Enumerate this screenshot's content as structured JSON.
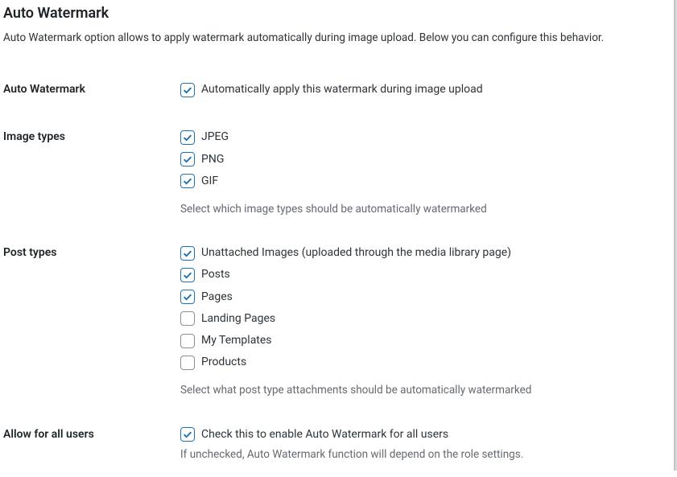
{
  "page": {
    "title": "Auto Watermark",
    "description": "Auto Watermark option allows to apply watermark automatically during image upload. Below you can configure this behavior."
  },
  "sections": {
    "auto_watermark": {
      "heading": "Auto Watermark",
      "option_label": "Automatically apply this watermark during image upload",
      "option_checked": true
    },
    "image_types": {
      "heading": "Image types",
      "items": [
        {
          "label": "JPEG",
          "checked": true
        },
        {
          "label": "PNG",
          "checked": true
        },
        {
          "label": "GIF",
          "checked": true
        }
      ],
      "hint": "Select which image types should be automatically watermarked"
    },
    "post_types": {
      "heading": "Post types",
      "items": [
        {
          "label": "Unattached Images (uploaded through the media library page)",
          "checked": true
        },
        {
          "label": "Posts",
          "checked": true
        },
        {
          "label": "Pages",
          "checked": true
        },
        {
          "label": "Landing Pages",
          "checked": false
        },
        {
          "label": "My Templates",
          "checked": false
        },
        {
          "label": "Products",
          "checked": false
        }
      ],
      "hint": "Select what post type attachments should be automatically watermarked"
    },
    "allow_all": {
      "heading": "Allow for all users",
      "option_label": "Check this to enable Auto Watermark for all users",
      "option_checked": true,
      "hint": "If unchecked, Auto Watermark function will depend on the role settings."
    }
  }
}
